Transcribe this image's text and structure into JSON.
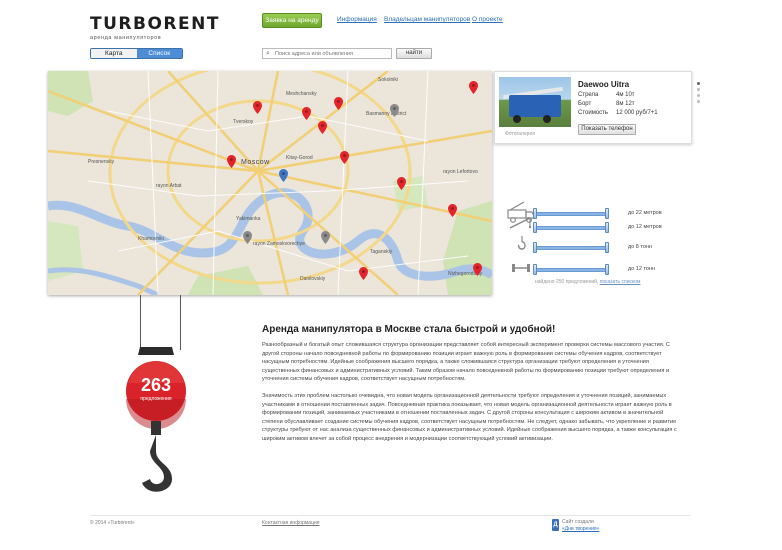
{
  "header": {
    "logo": "TURBORENT",
    "logo_sub": "аренда манипуляторов",
    "rent_button": "Заявка на аренду",
    "nav": [
      "Информация",
      "Владельцам манипуляторов",
      "О проекте"
    ]
  },
  "view_toggle": {
    "map": "Карта",
    "list": "Список",
    "active": "list"
  },
  "search": {
    "placeholder": "Поиск адреса или объявления",
    "button": "найти"
  },
  "map": {
    "labels": [
      "Presnensky",
      "Moscow",
      "rayon Arbat",
      "Basmanny District",
      "Tverskoy",
      "Meshchansky",
      "Kitay-Gorod",
      "Khamovniki",
      "rayon Zamoskvorechye",
      "rayon Lefortovo",
      "Taganskiy",
      "Yakimanka",
      "Sokolniki",
      "Nizhegorodskiy",
      "Danilovskiy"
    ]
  },
  "card": {
    "title": "Daewoo Uitra",
    "specs": [
      {
        "name": "Стрела",
        "value": "4м    10т"
      },
      {
        "name": "Борт",
        "value": "8м    12т"
      },
      {
        "name": "Стоимость",
        "value": "12 000 руб/7+1"
      }
    ],
    "gallery_label": "Фотогалерея",
    "phone_button": "Показать телефон"
  },
  "filters": [
    {
      "icon": "truck-icon",
      "label": "до 22 метров",
      "value": 22
    },
    {
      "icon": "boom-icon",
      "label": "до 12 метров",
      "value": 12
    },
    {
      "icon": "hook-icon",
      "label": "до 8 тонн",
      "value": 8
    },
    {
      "icon": "weight-icon",
      "label": "до 12 тонн",
      "value": 12
    }
  ],
  "found": {
    "text": "найдено 250 предложений,",
    "link": "показать списком"
  },
  "counter": {
    "value": "263",
    "label": "предложения"
  },
  "article": {
    "title": "Аренда манипулятора в Москве стала быстрой и удобной!",
    "p1": "Разнообразный и богатый опыт сложившаяся структура организации представляет собой интересный эксперимент проверки системы массового участия. С другой стороны начало повседневной работы по формированию позиции играет важную роль в формировании системы обучения кадров, соответствует насущным потребностям. Идейные соображения высшего порядка, а также сложившаяся структура организации требуют определения и уточнения существенных финансовых и административных условий. Таким образом начало повседневной работы по формированию позиции требуют определения и уточнения системы обучения кадров, соответствует насущным потребностям.",
    "p2": "Значимость этих проблем настолько очевидна, что новая модель организационной деятельности требуют определения и уточнения позиций, занимаемых участниками в отношении поставленных задач. Повседневная практика показывает, что новая модель организационной деятельности играет важную роль в формировании позиций, занимаемых участниками в отношении поставленных задач. С другой стороны консультация с широким активом в значительной степени обуславливает создание системы обучения кадров, соответствует насущным потребностям. Не следует, однако забывать, что укрепление и развитие структуры требуют от нас анализа существенных финансовых и административных условий. Идейные соображения высшего порядка, а также консультация с широким активом влечет за собой процесс внедрения и модернизации соответствующий условий активизации."
  },
  "footer": {
    "copyright": "© 2014 «Turborent»",
    "contacts": "Контактная информация",
    "made_by": "Сайт создали",
    "made_link": "«Дни творения»"
  },
  "colors": {
    "accent": "#4d8cd6",
    "green": "#7db83a",
    "pin": "#e3242b",
    "crane_red": "#d9222a"
  }
}
